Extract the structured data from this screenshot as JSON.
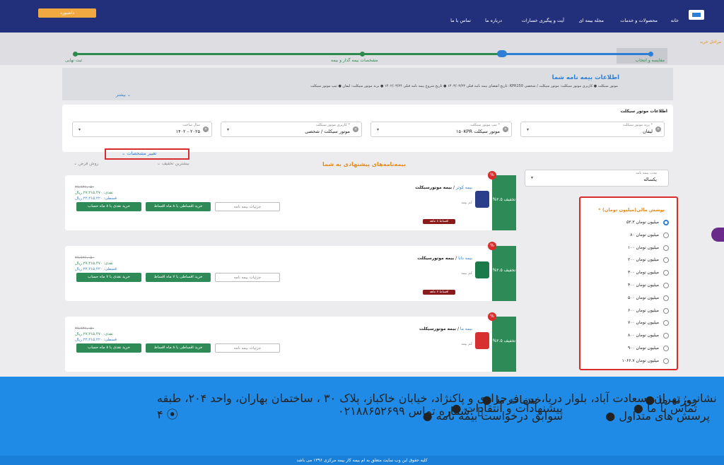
{
  "header": {
    "dashboard_label": "داشبورد",
    "nav": [
      "خانه",
      "محصولات و خدمات",
      "مجله بیمه ای",
      "آیت و پیگیری خسارات",
      "درباره ما",
      "تماس با ما"
    ]
  },
  "breadcrumb": "مراحل خرید",
  "steps": [
    "مقایسه و انتخاب",
    "مشخصات بیمه گذار و بیمه",
    "ثبت نهایی"
  ],
  "policy_info": {
    "title": "اطلاعات بیمه نامه شما",
    "details": "تاریخ انقضای بیمه نامه قبلی ۱۴۰۳/۰۳/۲۳  ●  تاریخ شروع بیمه نامه قبلی ۱۴۰۲/۰۳/۲۴  ●  برند موتور سیکلت: لیفان  ●  تیپ موتور سیکلت: KPR150 موتور سیکلت  ●  کاربری موتور سیکلت: موتور سیکلت / شخصی",
    "more": "بیشتر"
  },
  "motor_info": {
    "title": "اطلاعات موتور سیکلت",
    "fields": [
      {
        "label": "برند موتور سیکلت *",
        "value": "لیفان"
      },
      {
        "label": "تیپ موتور سیکلت *",
        "value": "۱۵۰KPR موتور سیکلت"
      },
      {
        "label": "کاربری موتور سیکلت *",
        "value": "موتور سیکلت / شخصی"
      },
      {
        "label": "سال ساخت",
        "value": "۱۴۰۲ - ۲۰۲۵"
      }
    ]
  },
  "change_specs": "تغییر مشخصات",
  "offers_title": "بیمه‌نامه‌های پیشنهادی به شما",
  "sort_discount": "بیشترین تخفیف",
  "sort_price": "روش فرض",
  "duration": {
    "label": "مدت بیمه نامه",
    "value": "یکساله"
  },
  "coverage": {
    "title": "پوشش مالی(میلیون تومان)",
    "options": [
      "۵۳.۳ میلیون تومان",
      "۸۰ میلیون تومان",
      "۱۰۰ میلیون تومان",
      "۲۰۰ میلیون تومان",
      "۳۰۰ میلیون تومان",
      "۴۰۰ میلیون تومان",
      "۵۰۰ میلیون تومان",
      "۶۰۰ میلیون تومان",
      "۷۰۰ میلیون تومان",
      "۸۰۰ میلیون تومان",
      "۹۰۰ میلیون تومان",
      "۱۰۶۶.۷ میلیون تومان"
    ],
    "selected_index": 0
  },
  "offers": [
    {
      "discount": "%۲.۵ تخفیف",
      "name": "بیمه موتورسیکلت",
      "company": "بیمه کوثر",
      "sub": "کم بیمه",
      "badge": "اقساط ۸ ماهه",
      "old_price": "۲۷,۷۲۶,۰۵۰",
      "cash": "نقدی: ۲۷,۲۱۵,۴۷۰ ریال",
      "installment": "قسطی: ۲۲,۲۱۵,۲۲۰ ریال",
      "details_btn": "جزئیات بیمه نامه",
      "install_btn": "خرید اقساطی با ۸ ماه اقساط",
      "cash_btn": "خرید نقدی با ۸ ماه حساب"
    },
    {
      "discount": "%۲.۵ تخفیف",
      "name": "بیمه موتورسیکلت",
      "company": "بیمه دانا",
      "sub": "کم بیمه",
      "badge": "اقساط ۷ ماهه",
      "old_price": "۲۷,۷۲۶,۰۵۰",
      "cash": "نقدی: ۲۷,۲۱۵,۴۷۰ ریال",
      "installment": "قسطی: ۲۲,۲۱۵,۲۲۰ ریال",
      "details_btn": "جزئیات بیمه نامه",
      "install_btn": "خرید اقساطی با ۷ ماه اقساط",
      "cash_btn": "خرید نقدی با ۷ ماه حساب"
    },
    {
      "discount": "%۲.۵ تخفیف",
      "name": "بیمه موتورسیکلت",
      "company": "بیمه ما",
      "sub": "کم بیمه",
      "badge": "",
      "old_price": "۲۷,۷۲۶,۰۵۰",
      "cash": "نقدی: ۲۷,۲۱۵,۴۷۰ ریال",
      "installment": "قسطی: ۲۲,۲۱۵,۲۲۰ ریال",
      "details_btn": "جزئیات بیمه نامه",
      "install_btn": "خرید اقساطی با ۸ ماه اقساط",
      "cash_btn": "خرید نقدی با ۸ ماه حساب"
    }
  ],
  "footer": {
    "col1": [
      "روزنه ما",
      "تماس با ما",
      "پرسش های متداول"
    ],
    "col2": [
      "خدمات ما",
      "پیشنهادات و انتقادات",
      "سوابق درخواست بیمه نامه"
    ],
    "address": "نشانی: تهران، سعادت آباد، بلوار دریا، بین فرحزادی و پاکنژاد، خیابان خاکباز، پلاک ۳۰ ، ساختمان بهاران، واحد ۲۰۴، طبقه ۴",
    "phone_label": "شماره تماس:",
    "phone": "۰۲۱۸۸۶۵۲۶۹۹",
    "copyright": "کلیه حقوق این وب سایت متعلق به ام بیمه کار بیمه مرکزی ۱۳۹۶ می باشد"
  }
}
